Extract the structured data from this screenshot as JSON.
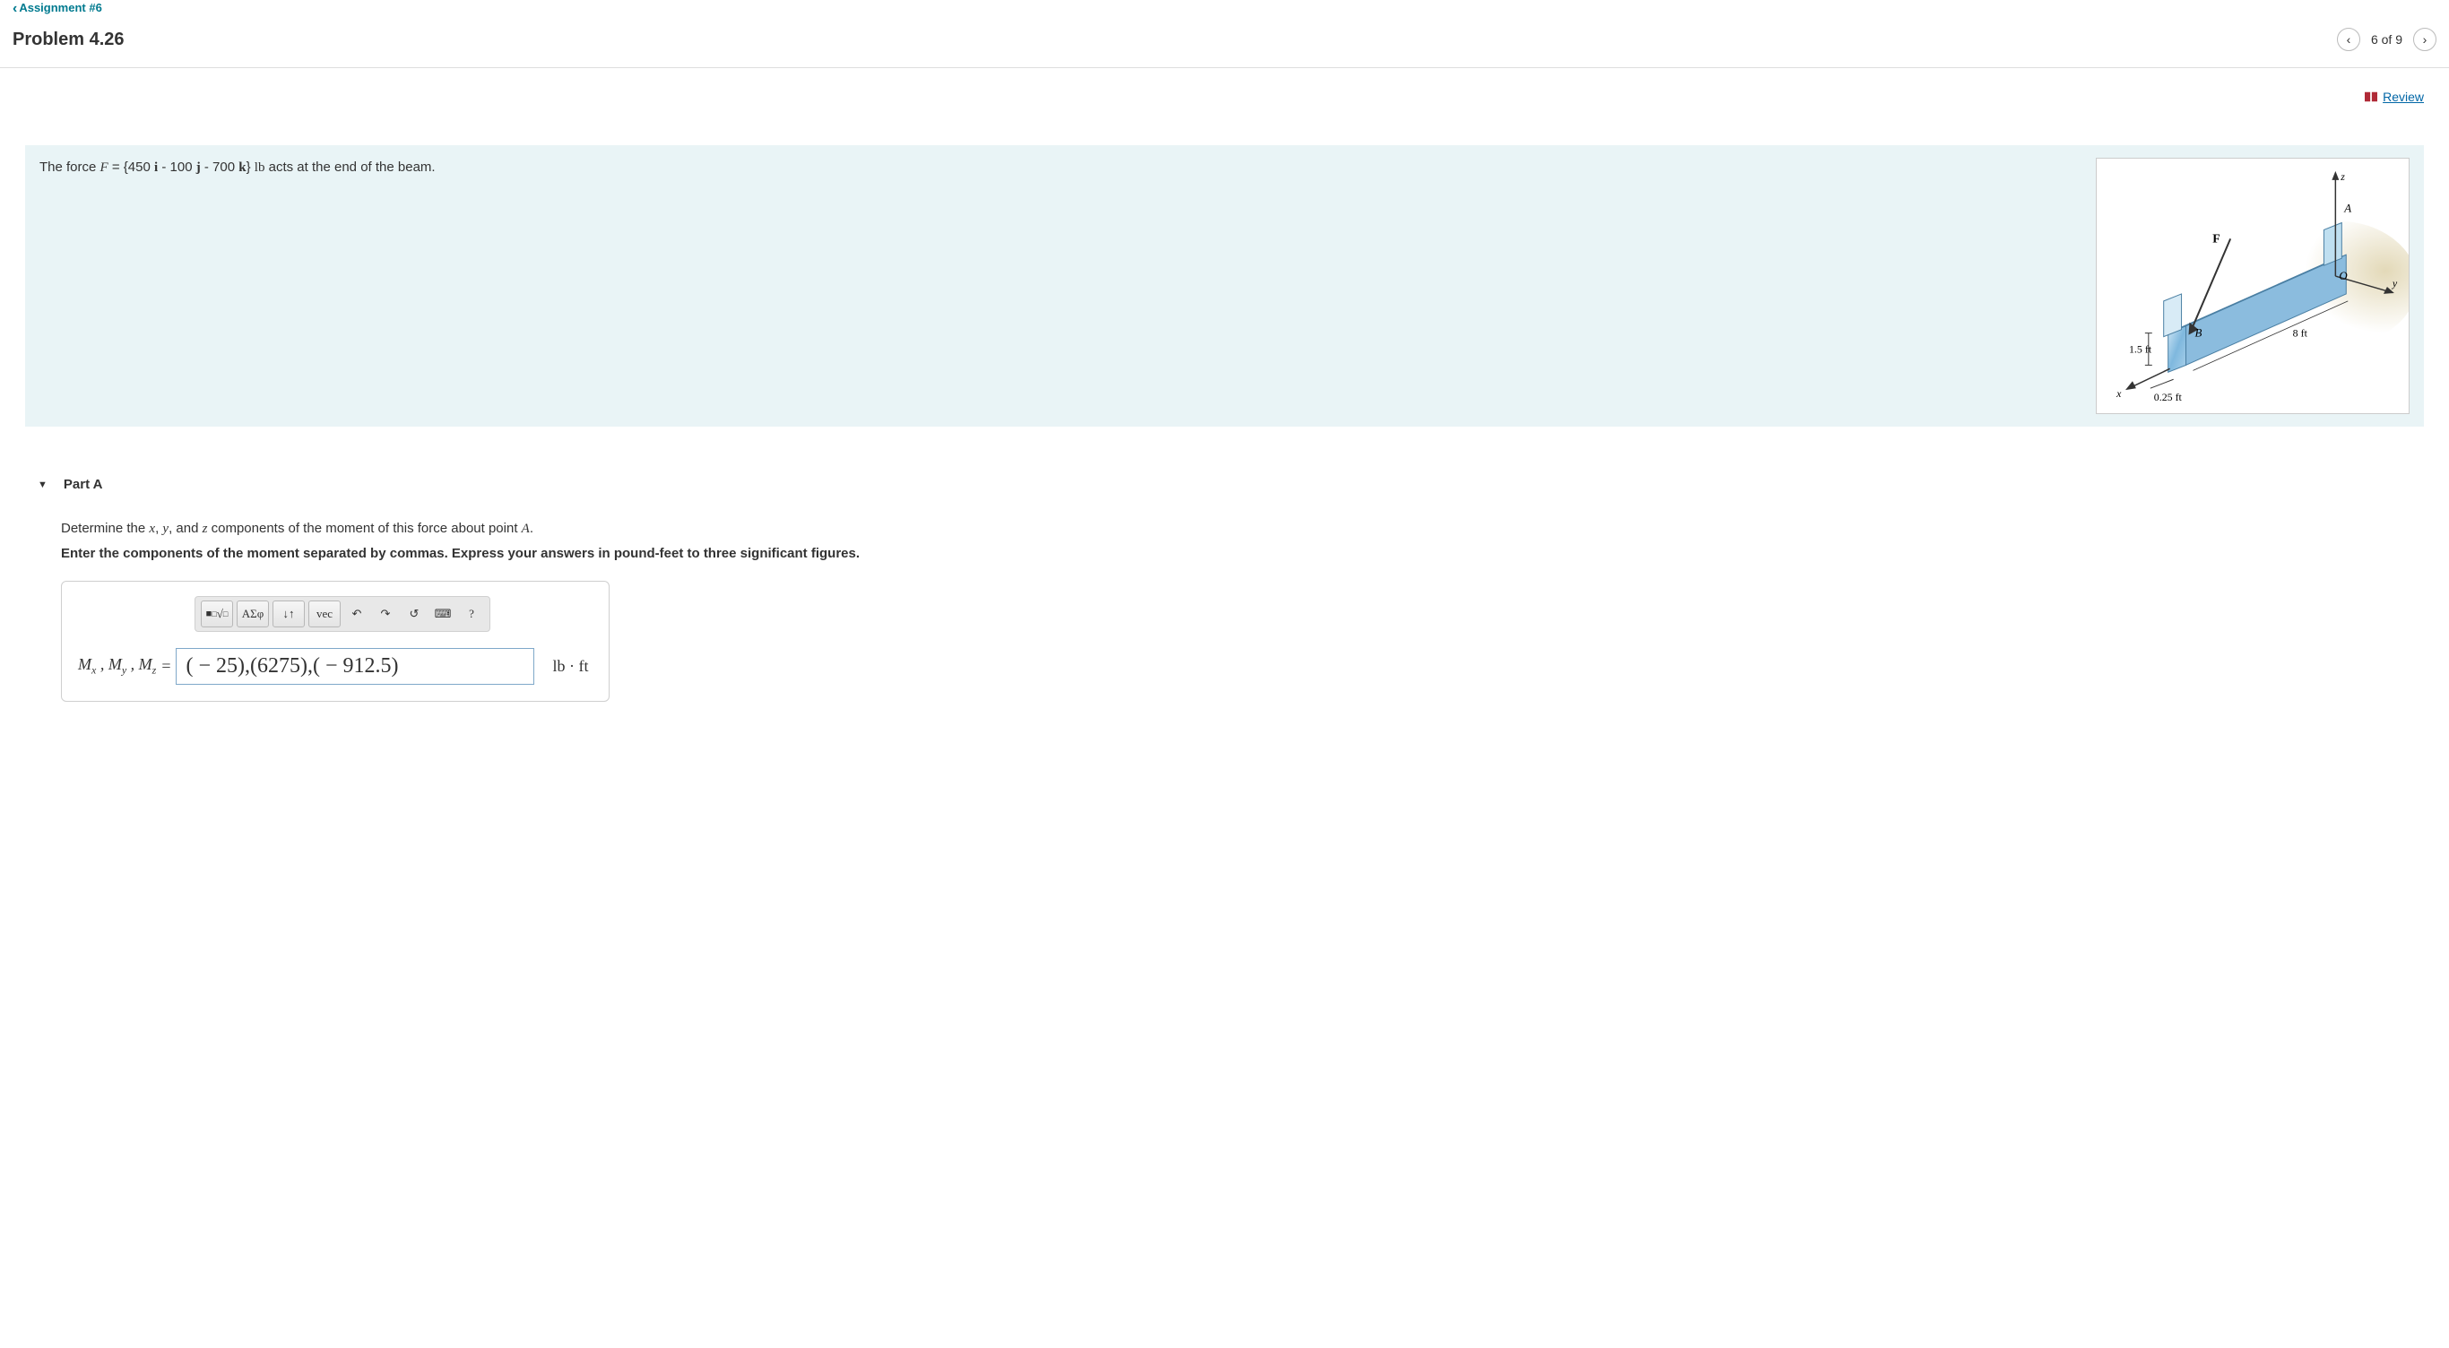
{
  "nav": {
    "back_link": "Assignment #6",
    "problem_title": "Problem 4.26",
    "counter": "6 of 9",
    "review": "Review"
  },
  "problem": {
    "pre": "The force ",
    "eq_text": "F = {450 i - 100 j - 700 k} lb",
    "post": " acts at the end of the beam."
  },
  "figure": {
    "labels": {
      "x": "x",
      "y": "y",
      "z": "z",
      "A": "A",
      "B": "B",
      "F": "F",
      "O": "O"
    },
    "dims": {
      "h": "1.5 ft",
      "w": "0.25 ft",
      "len": "8 ft"
    }
  },
  "partA": {
    "header": "Part A",
    "question_pre": "Determine the ",
    "question_mid1": ", ",
    "question_mid2": ", and ",
    "question_post": " components of the moment of this force about point ",
    "question_end": ".",
    "instruct": "Enter the components of the moment separated by commas. Express your answers in pound-feet to three significant figures.",
    "toolbar": {
      "templates": "■√□",
      "greek": "ΑΣφ",
      "subsup": "↓↑",
      "vec": "vec",
      "undo": "↶",
      "redo": "↷",
      "reset": "↺",
      "keyboard": "⌨",
      "help": "?"
    },
    "lhs": "Mₓ , Mᵧ , M_z",
    "answer": "( − 25),(6275),( − 912.5)",
    "units": "lb · ft"
  }
}
